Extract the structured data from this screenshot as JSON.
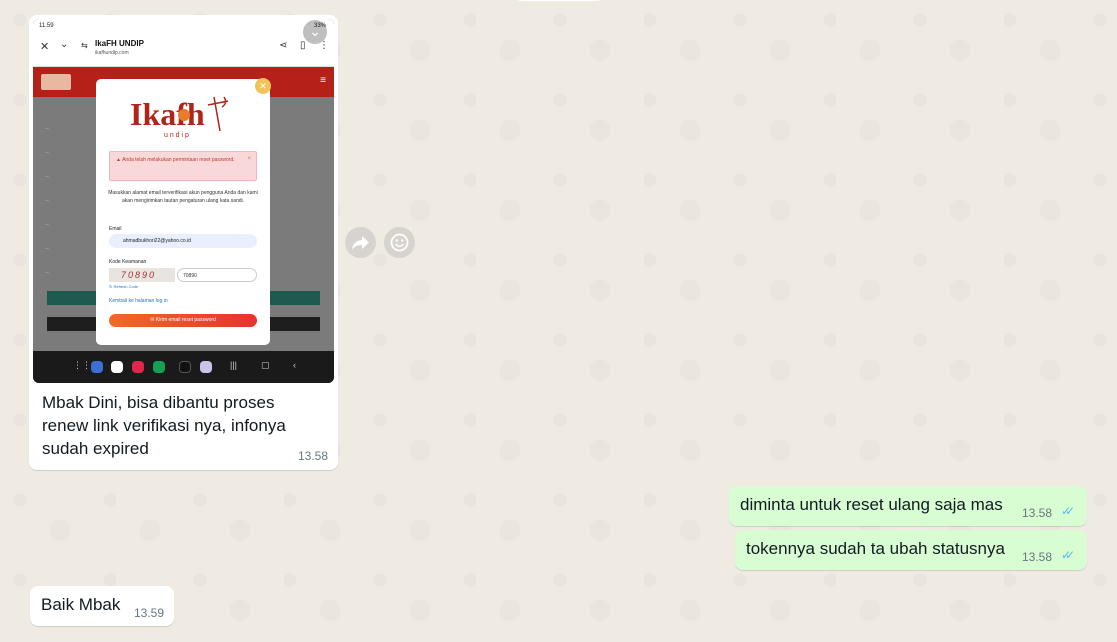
{
  "conversation": {
    "incoming_image_message": {
      "caption": "Mbak Dini, bisa dibantu proses renew link verifikasi nya, infonya sudah expired",
      "time": "13.58",
      "screenshot": {
        "status_time": "11.59",
        "status_right": "33%",
        "browser_title": "IkaFH UNDIP",
        "browser_url": "ikafhundip.com",
        "modal": {
          "logo_text": "Ikafh",
          "logo_sub": "u n d i p",
          "alert_text": "Anda telah melakukan permintaan reset password.",
          "description": "Masukkan alamat email terverifikasi akun pengguna Anda dan kami akan mengirimkan tautan pengaturan ulang kata sandi.",
          "email_label": "Email",
          "email_value": "ahmadbukhori22@yahoo.co.id",
          "security_label": "Kode Keamanan",
          "captcha_text": "70890",
          "captcha_value": "70890",
          "refresh_label": "Refresh Code",
          "back_link": "Kembali ke halaman log in",
          "submit_label": "Kirim email reset password"
        }
      }
    },
    "outgoing_messages": [
      {
        "text": "diminta untuk reset ulang saja mas",
        "time": "13.58",
        "status": "read"
      },
      {
        "text": "tokennya sudah ta ubah statusnya",
        "time": "13.58",
        "status": "read"
      }
    ],
    "incoming_text_message": {
      "text": "Baik Mbak",
      "time": "13.59"
    },
    "colors": {
      "background": "#efeae2",
      "outgoing_bubble": "#d9fdd3",
      "incoming_bubble": "#ffffff",
      "read_ticks": "#53bdeb"
    },
    "icons": [
      "forward-icon",
      "emoji-reaction-icon",
      "double-check-icon"
    ]
  }
}
